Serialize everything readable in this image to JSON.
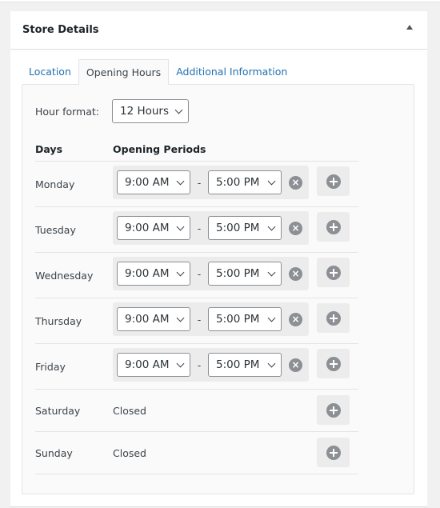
{
  "panel": {
    "title": "Store Details"
  },
  "tabs": [
    {
      "label": "Location"
    },
    {
      "label": "Opening Hours",
      "active": true
    },
    {
      "label": "Additional Information"
    }
  ],
  "hour_format": {
    "label": "Hour format:",
    "value": "12 Hours"
  },
  "table": {
    "headers": [
      "Days",
      "Opening Periods"
    ],
    "rows": [
      {
        "day": "Monday",
        "open": "9:00 AM",
        "close": "5:00 PM"
      },
      {
        "day": "Tuesday",
        "open": "9:00 AM",
        "close": "5:00 PM"
      },
      {
        "day": "Wednesday",
        "open": "9:00 AM",
        "close": "5:00 PM"
      },
      {
        "day": "Thursday",
        "open": "9:00 AM",
        "close": "5:00 PM"
      },
      {
        "day": "Friday",
        "open": "9:00 AM",
        "close": "5:00 PM"
      },
      {
        "day": "Saturday",
        "status": "Closed"
      },
      {
        "day": "Sunday",
        "status": "Closed"
      }
    ],
    "separator": "-"
  },
  "colors": {
    "link": "#2271b1",
    "icon": "#8c8f94"
  }
}
